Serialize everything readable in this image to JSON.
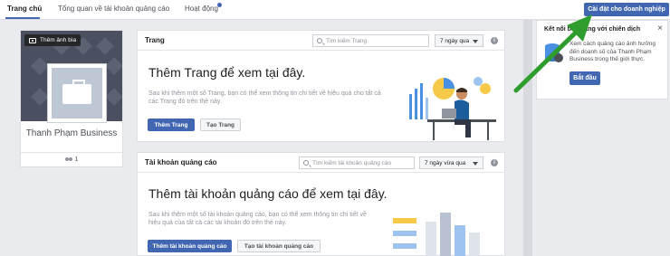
{
  "tabs": [
    {
      "label": "Trang chủ",
      "active": true
    },
    {
      "label": "Tổng quan về tài khoản quảng cáo",
      "active": false
    },
    {
      "label": "Hoạt động",
      "active": false
    }
  ],
  "header": {
    "setup_button": "Cài đặt cho doanh nghiệp"
  },
  "profile": {
    "cover_button": "Thêm ảnh bìa",
    "name": "Thanh Phạm Business",
    "likes": "1"
  },
  "pages_card": {
    "title": "Trang",
    "search_placeholder": "Tìm kiếm Trang",
    "range": "7 ngày qua",
    "empty_title": "Thêm Trang để xem tại đây.",
    "empty_desc": "Sau khi thêm một số Trang, bạn có thể xem thông tin chi tiết về hiệu quả cho tất cả các Trang đó trên thẻ này.",
    "add_button": "Thêm Trang",
    "create_button": "Tạo Trang"
  },
  "ads_card": {
    "title": "Tài khoản quảng cáo",
    "search_placeholder": "Tìm kiếm tài khoản quảng cáo",
    "range": "7 ngày vừa qua",
    "empty_title": "Thêm tài khoản quảng cáo để xem tại đây.",
    "empty_desc": "Sau khi thêm một số tài khoản quảng cáo, bạn có thể xem thông tin chi tiết về hiệu quả của tất cả các tài khoản đó trên thẻ này.",
    "add_button": "Thêm tài khoản quảng cáo",
    "create_button": "Tạo tài khoản quảng cáo"
  },
  "right_panel": {
    "title": "Kết nối bán hàng với chiến dịch",
    "text": "Xem cách quảng cáo ảnh hưởng đến doanh số của Thanh Phạm Business trong thế giới thực.",
    "button": "Bắt đầu"
  },
  "colors": {
    "accent": "#4267b2",
    "background": "#e9ebee",
    "arrow": "#2e9d2e"
  },
  "icons": [
    "camera-icon",
    "briefcase-icon",
    "people-icon",
    "search-icon",
    "caret-down-icon",
    "info-icon",
    "close-icon",
    "database-icon"
  ]
}
